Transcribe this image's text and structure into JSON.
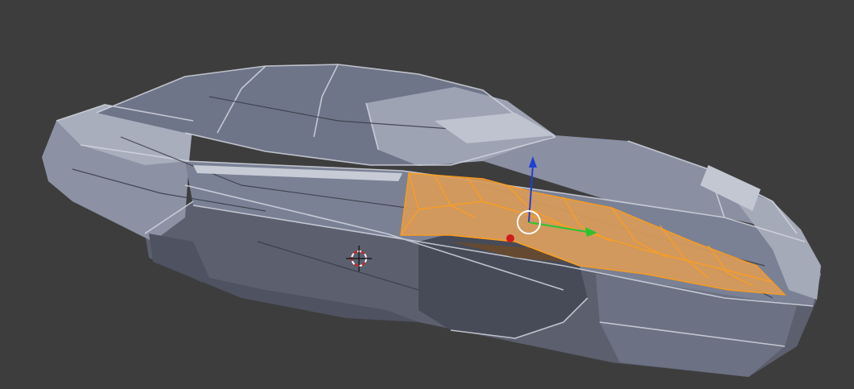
{
  "viewport": {
    "background": "#3d3d3d",
    "mesh_colors": {
      "light": "#b3b8c8",
      "mid": "#8d93a8",
      "dark": "#5d6274",
      "shadow": "#474b58",
      "edge": "#d6d9e2"
    },
    "selection": {
      "fill": "#d99c5a",
      "edge": "#ff9e1b"
    },
    "gizmo": {
      "x_color": "#d11b1b",
      "y_color": "#2fc22f",
      "z_color": "#1f3fd6",
      "center_color": "#ffffff"
    },
    "cursor_3d": {
      "ring_colors": [
        "#ffffff",
        "#d22222"
      ],
      "cross_color": "#111111"
    }
  }
}
